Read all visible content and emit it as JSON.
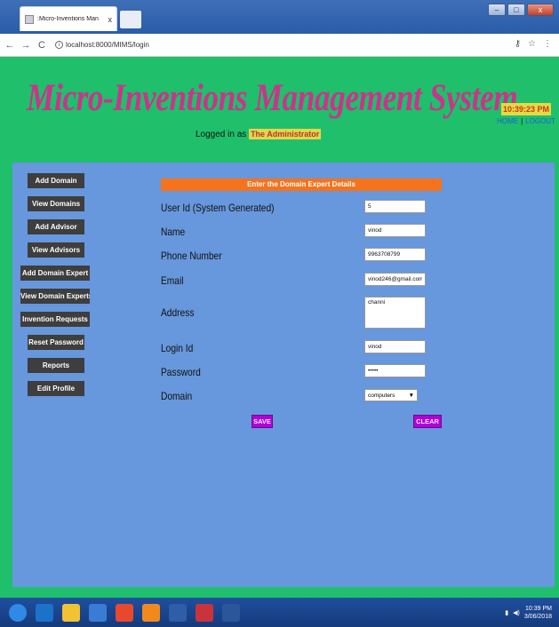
{
  "browser": {
    "tab_title": ":Micro-Inventions Man",
    "tab_close": "x",
    "url": "localhost:8000/MIMS/login",
    "back": "←",
    "forward": "→",
    "reload": "C",
    "info": "i",
    "key": "⚷",
    "star": "☆",
    "menu": "⋮",
    "win_min": "–",
    "win_max": "□",
    "win_close": "x"
  },
  "header": {
    "title": "Micro-Inventions Management System",
    "logged_prefix": "Logged in as",
    "logged_user": "The Administrator",
    "clock": "10:39:23 PM",
    "home_link": "HOME",
    "separator": "|",
    "logout_link": "LOGOUT"
  },
  "sidebar": {
    "items": [
      {
        "label": "Add Domain"
      },
      {
        "label": "View Domains"
      },
      {
        "label": "Add Advisor"
      },
      {
        "label": "View Advisors"
      },
      {
        "label": "Add Domain Expert"
      },
      {
        "label": "View Domain Experts"
      },
      {
        "label": "Invention Requests"
      },
      {
        "label": "Reset Password"
      },
      {
        "label": "Reports"
      },
      {
        "label": "Edit Profile"
      }
    ]
  },
  "form": {
    "heading": "Enter the Domain Expert Details",
    "user_id_label": "User Id (System Generated)",
    "user_id_value": "5",
    "name_label": "Name",
    "name_value": "vinod",
    "phone_label": "Phone Number",
    "phone_value": "9963708799",
    "email_label": "Email",
    "email_value": "vinod246@gmail.com",
    "address_label": "Address",
    "address_value": "channi",
    "login_label": "Login Id",
    "login_value": "vinod",
    "password_label": "Password",
    "password_value": "•••••",
    "domain_label": "Domain",
    "domain_value": "computers",
    "domain_arrow": "▼",
    "save_label": "SAVE",
    "clear_label": "CLEAR"
  },
  "taskbar": {
    "time": "10:39 PM",
    "date": "3/06/2018",
    "colors": [
      "#2e8ae6",
      "#1a73c9",
      "#f1c232",
      "#3a7bd5",
      "#e8492e",
      "#f08a1e",
      "#2f5da8",
      "#c9333a",
      "#2b579a"
    ]
  }
}
